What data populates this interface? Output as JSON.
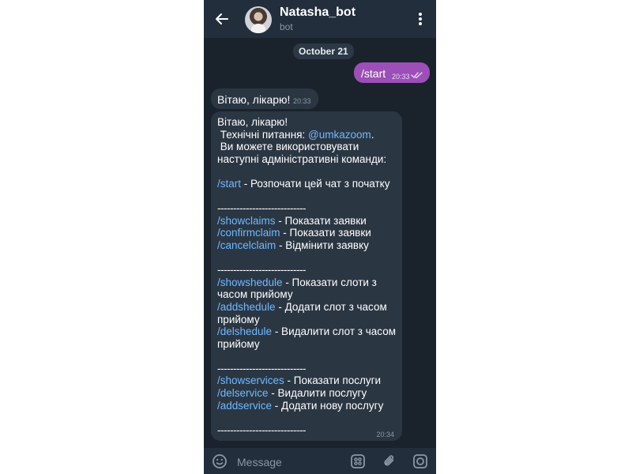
{
  "header": {
    "title": "Natasha_bot",
    "subtitle": "bot"
  },
  "chat": {
    "date_label": "October 21",
    "outgoing": {
      "text": "/start",
      "time": "20:33"
    },
    "incoming_short": {
      "text": "Вітаю, лікарю!",
      "time": "20:33"
    },
    "incoming_long": {
      "time": "20:34",
      "greeting": "Вітаю, лікарю!",
      "support_prefix": " Технічні питання: ",
      "support_link": "@umkazoom",
      "support_suffix": ".",
      "intro_line1": " Ви можете використовувати",
      "intro_line2": "наступні адміністративні команди:",
      "start_cmd": "/start",
      "start_desc": " - Розпочати цей чат з початку",
      "separator": "----------------------------",
      "showclaims_cmd": "/showclaims",
      "showclaims_desc": " - Показати заявки",
      "confirmclaim_cmd": "/confirmclaim",
      "confirmclaim_desc": " - Показати заявки",
      "cancelclaim_cmd": "/cancelclaim",
      "cancelclaim_desc": " - Відмінити заявку",
      "showshedule_cmd": "/showshedule",
      "showshedule_desc": " - Показати слоти з часом прийому",
      "addshedule_cmd": "/addshedule",
      "addshedule_desc": " - Додати слот з часом прийому",
      "delshedule_cmd": "/delshedule",
      "delshedule_desc": " - Видалити слот з часом прийому",
      "showservices_cmd": "/showservices",
      "showservices_desc": " - Показати послуги",
      "delservice_cmd": "/delservice",
      "delservice_desc": " - Видалити послугу",
      "addservice_cmd": "/addservice",
      "addservice_desc": " - Додати нову послугу"
    }
  },
  "input": {
    "placeholder": "Message"
  },
  "icons": {
    "back": "arrow-left-icon",
    "menu": "more-vertical-icon",
    "emoji": "emoji-icon",
    "commands": "bot-commands-icon",
    "attach": "paperclip-icon",
    "camera": "camera-icon",
    "read": "double-check-icon"
  },
  "colors": {
    "background": "#1a222c",
    "header": "#232e3c",
    "outgoing_bubble": "#9b4fb7",
    "incoming_bubble": "#2b3643",
    "link": "#6fb9ff"
  }
}
